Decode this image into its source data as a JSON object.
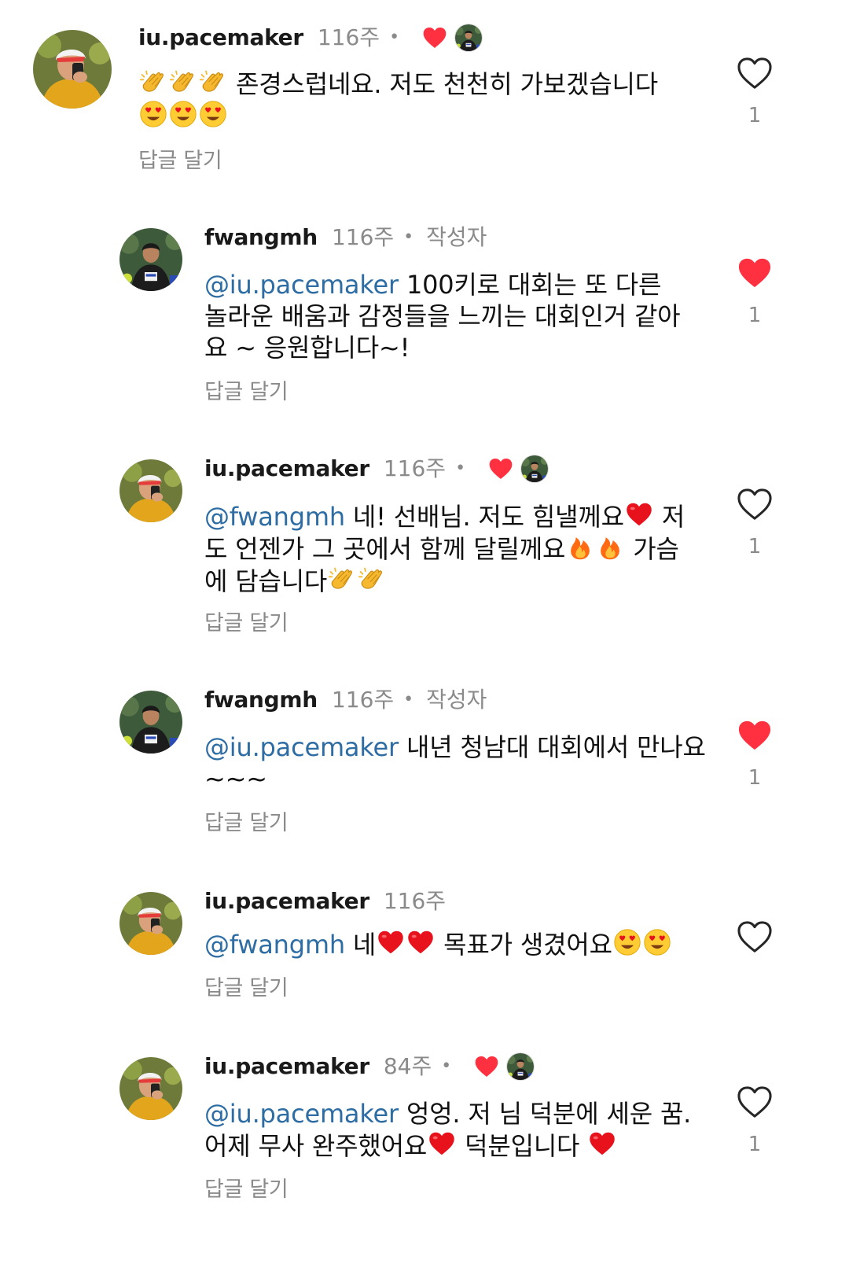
{
  "comments": [
    {
      "username": "iu.pacemaker",
      "time": "116주",
      "liked_by_author": true,
      "is_author": false,
      "text_before": "",
      "mention": "",
      "text_main": "존경스럽네요. 저도 천천히 가보겠습니다",
      "reply_label": "답글 달기",
      "liked": false,
      "like_count": "1"
    },
    {
      "username": "fwangmh",
      "time": "116주",
      "author_label": "작성자",
      "mention": "@iu.pacemaker",
      "text_main": "100키로 대회는 또 다른 놀라운 배움과 감정들을 느끼는 대회인거 같아요 ~ 응원합니다~!",
      "reply_label": "답글 달기",
      "liked": true,
      "like_count": "1"
    },
    {
      "username": "iu.pacemaker",
      "time": "116주",
      "mention": "@fwangmh",
      "text_a": "네! 선배님. 저도 힘낼께요",
      "text_b": "저도 언젠가 그 곳에서 함께 달릴께요",
      "text_c": "가슴에 담습니다",
      "reply_label": "답글 달기",
      "liked": false,
      "like_count": "1"
    },
    {
      "username": "fwangmh",
      "time": "116주",
      "author_label": "작성자",
      "mention": "@iu.pacemaker",
      "text_main": "내년 청남대 대회에서 만나요 ~~~",
      "reply_label": "답글 달기",
      "liked": true,
      "like_count": "1"
    },
    {
      "username": "iu.pacemaker",
      "time": "116주",
      "mention": "@fwangmh",
      "text_a": "네",
      "text_b": "목표가 생겼어요",
      "reply_label": "답글 달기",
      "liked": false,
      "like_count": ""
    },
    {
      "username": "iu.pacemaker",
      "time": "84주",
      "mention": "@iu.pacemaker",
      "text_a": "엉엉. 저 님 덕분에 세운 꿈. 어제 무사 완주했어요",
      "text_b": "덕분입니다",
      "reply_label": "답글 달기",
      "liked": false,
      "like_count": "1"
    }
  ],
  "dot_separator": "•",
  "colors": {
    "mention": "#2e6da4",
    "like_red": "#ff3040",
    "muted": "#8a8a8a"
  },
  "icons": [
    "heart-outline-icon",
    "heart-filled-icon",
    "clap-emoji",
    "heart-eyes-emoji",
    "red-heart-emoji",
    "fire-emoji"
  ]
}
